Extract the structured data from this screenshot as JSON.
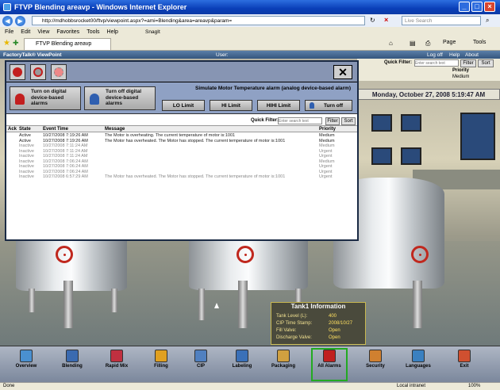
{
  "window": {
    "title": "FTVP Blending areavp - Windows Internet Explorer"
  },
  "address": {
    "url": "http://mdhobbsrocket00/ftvp/viewpoint.aspx?=ami=Blending&area=areavp&param=",
    "search_placeholder": "Live Search"
  },
  "menu": [
    "File",
    "Edit",
    "View",
    "Favorites",
    "Tools",
    "Help"
  ],
  "favbar": {
    "tab_label": "FTVP Blending areavp",
    "snagit": "SnagIt",
    "page": "Page",
    "tools": "Tools"
  },
  "ft": {
    "brand": "FactoryTalk® ViewPoint",
    "user_label": "User:",
    "logoff": "Log off",
    "help": "Help",
    "about": "About"
  },
  "topfilter": {
    "label": "Quick Filter:",
    "placeholder": "Enter search text",
    "filter_btn": "Filter",
    "sort_btn": "Sort",
    "priority_header": "Priority",
    "priority_value": "Medium"
  },
  "datetime": "Monday, October 27, 2008   5:19:47 AM",
  "popup": {
    "btn_on": "Turn on digital device-based alarms",
    "btn_off": "Turn off digital device-based alarms",
    "sim_label": "Simulate Motor Temperature alarm (analog device-based alarm)",
    "lo": "LO Limit",
    "hi": "HI Limit",
    "hihi": "HIHI Limit",
    "turnoff": "Turn off",
    "qf_label": "Quick Filter:",
    "qf_placeholder": "Enter search text",
    "filter": "Filter",
    "sort": "Sort",
    "headers": {
      "ack": "Ack",
      "state": "State",
      "time": "Event Time",
      "msg": "Message",
      "prio": "Priority"
    },
    "rows": [
      {
        "state": "Active",
        "time": "10/27/2008 7:19:26 AM",
        "msg": "The Motor is overheating. The current temperature of motor is:1001",
        "prio": "Medium"
      },
      {
        "state": "Active",
        "time": "10/27/2008 7:19:26 AM",
        "msg": "The Motor has overheated. The Motor has stopped. The current temperature of motor is:1001",
        "prio": "Medium"
      },
      {
        "state": "Inactive",
        "time": "10/27/2008 7:11:24 AM",
        "msg": "",
        "prio": "Medium"
      },
      {
        "state": "Inactive",
        "time": "10/27/2008 7:11:24 AM",
        "msg": "",
        "prio": "Urgent"
      },
      {
        "state": "Inactive",
        "time": "10/27/2008 7:11:24 AM",
        "msg": "",
        "prio": "Urgent"
      },
      {
        "state": "Inactive",
        "time": "10/27/2008 7:06:24 AM",
        "msg": "",
        "prio": "Medium"
      },
      {
        "state": "Inactive",
        "time": "10/27/2008 7:06:24 AM",
        "msg": "",
        "prio": "Urgent"
      },
      {
        "state": "Inactive",
        "time": "10/27/2008 7:06:24 AM",
        "msg": "",
        "prio": "Urgent"
      },
      {
        "state": "Inactive",
        "time": "10/27/2008 6:57:29 AM",
        "msg": "The Motor has overheated. The Motor has stopped. The current temperature of motor is:1001",
        "prio": "Urgent"
      }
    ]
  },
  "tankinfo": {
    "title": "Tank1 Information",
    "rows": [
      {
        "k": "Tank Level (L):",
        "v": "400"
      },
      {
        "k": "CIP Time Stamp:",
        "v": "2008/10/27"
      },
      {
        "k": "Fill Valve:",
        "v": "Open"
      },
      {
        "k": "Discharge Valve:",
        "v": "Open"
      }
    ]
  },
  "nav": [
    {
      "label": "Overview",
      "color": "#4a90d0"
    },
    {
      "label": "Blending",
      "color": "#3a6ab0"
    },
    {
      "label": "Rapid Mix",
      "color": "#c03040"
    },
    {
      "label": "Filling",
      "color": "#e0a020"
    },
    {
      "label": "CIP",
      "color": "#5080c0"
    },
    {
      "label": "Labeling",
      "color": "#3a70b8"
    },
    {
      "label": "Packaging",
      "color": "#d0a040"
    },
    {
      "label": "All Alarms",
      "color": "#c02020"
    },
    {
      "label": "Security",
      "color": "#d08030"
    },
    {
      "label": "Languages",
      "color": "#3a80c0"
    },
    {
      "label": "Exit",
      "color": "#d05030"
    }
  ],
  "status": {
    "left": "Done",
    "zone": "Local intranet",
    "zoom": "100%"
  }
}
